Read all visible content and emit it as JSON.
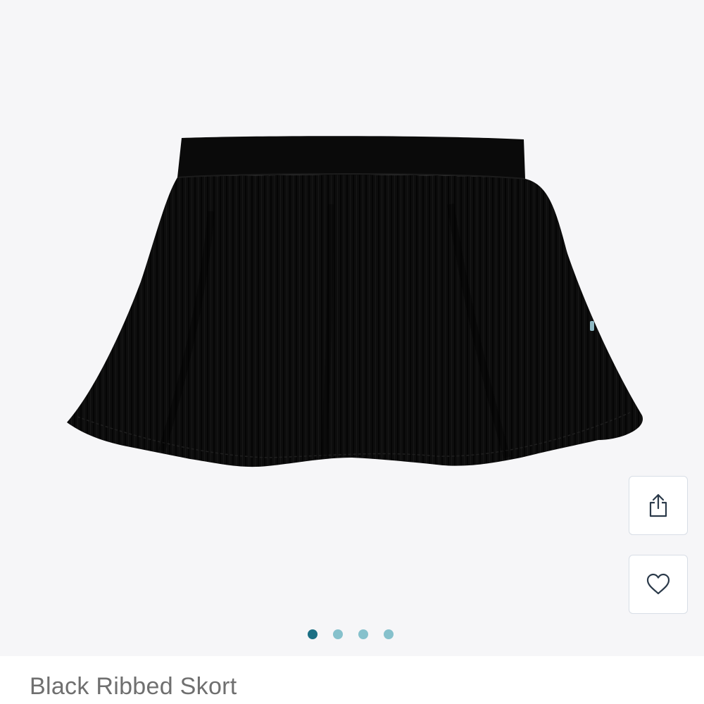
{
  "product": {
    "title": "Black Ribbed Skort"
  },
  "gallery": {
    "slide_count": 4,
    "active_index": 0,
    "colors": {
      "background": "#f6f6f8",
      "dot_active": "#1b6f84",
      "dot_inactive": "#86c1cc",
      "garment": "#0c0c0c"
    }
  },
  "actions": {
    "share_icon": "share-icon",
    "favorite_icon": "heart-icon"
  }
}
